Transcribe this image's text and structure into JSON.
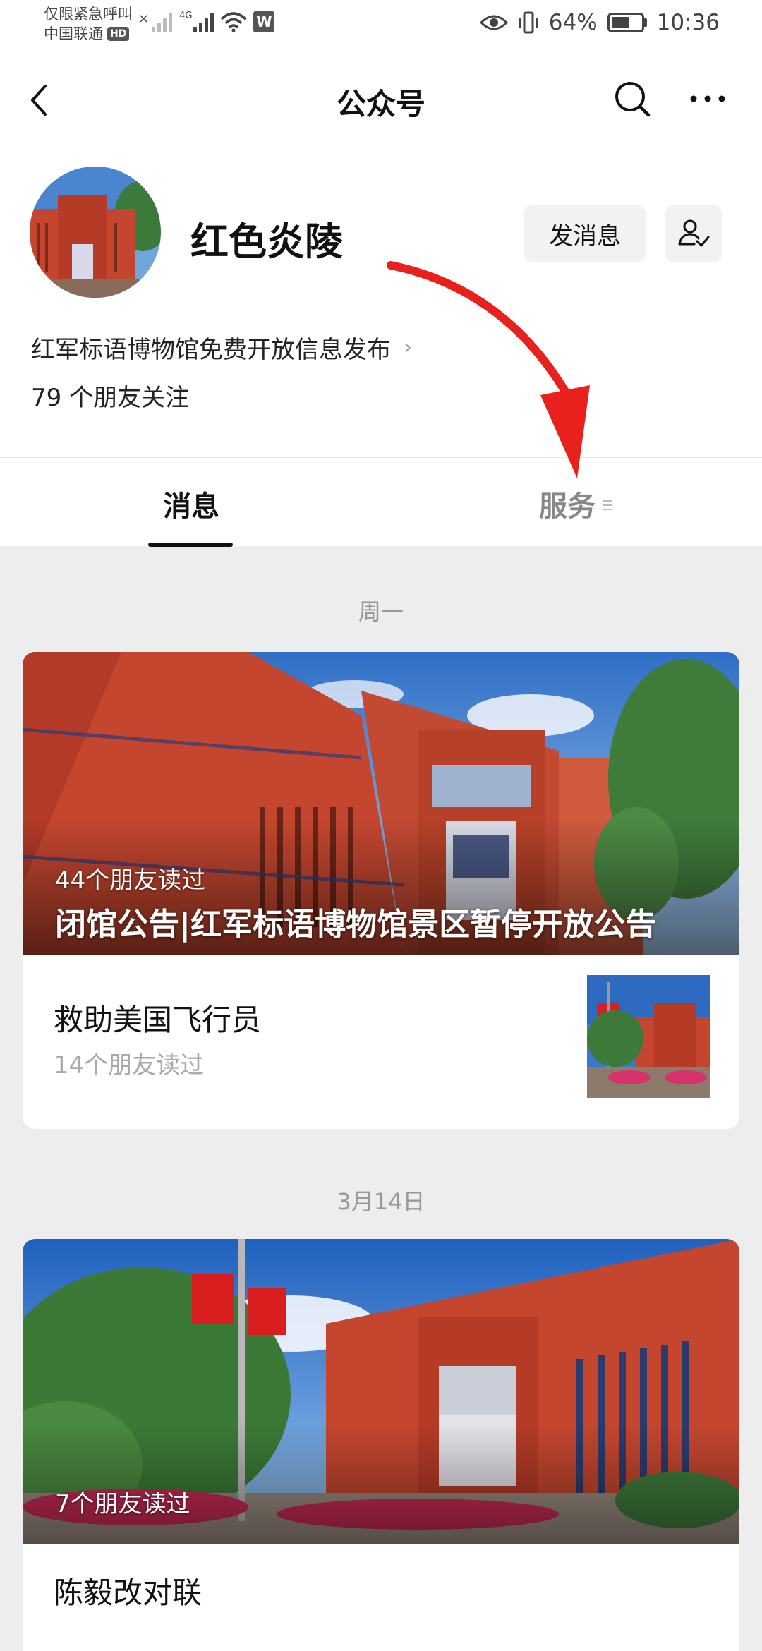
{
  "status_bar": {
    "line1": "仅限紧急呼叫",
    "carrier": "中国联通",
    "hd": "HD",
    "network": "4G",
    "app_badge": "W",
    "battery": "64%",
    "time": "10:36"
  },
  "nav": {
    "title": "公众号"
  },
  "profile": {
    "name": "红色炎陵",
    "send_message_label": "发消息",
    "description": "红军标语博物馆免费开放信息发布",
    "friends_follow": "79 个朋友关注"
  },
  "tabs": {
    "messages": "消息",
    "services": "服务"
  },
  "feed": {
    "groups": [
      {
        "date": "周一",
        "cover": {
          "reads": "44个朋友读过",
          "title": "闭馆公告|红军标语博物馆景区暂停开放公告"
        },
        "items": [
          {
            "title": "救助美国飞行员",
            "reads": "14个朋友读过"
          }
        ]
      },
      {
        "date": "3月14日",
        "cover": {
          "reads": "7个朋友读过"
        },
        "items": [
          {
            "title": "陈毅改对联"
          }
        ]
      }
    ]
  },
  "colors": {
    "background": "#ededed",
    "card": "#ffffff",
    "building_red": "#c5462f",
    "sky_blue": "#3a7fd0",
    "arrow_red": "#e8211c"
  }
}
